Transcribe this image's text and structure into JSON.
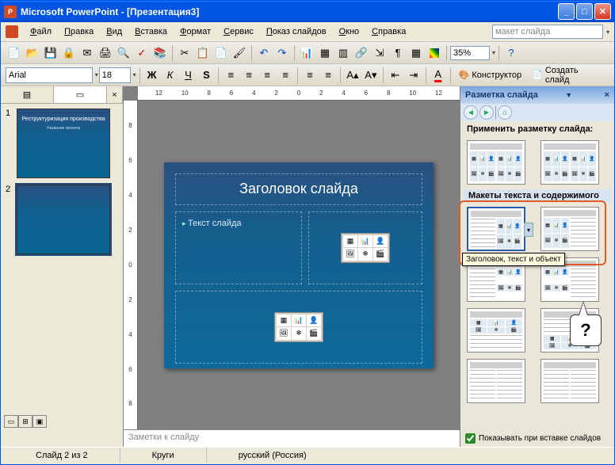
{
  "app": {
    "title": "Microsoft PowerPoint - [Презентация3]"
  },
  "menu": {
    "items": [
      "Файл",
      "Правка",
      "Вид",
      "Вставка",
      "Формат",
      "Сервис",
      "Показ слайдов",
      "Окно",
      "Справка"
    ],
    "help_box": "макет слайда"
  },
  "toolbar": {
    "zoom": "35%"
  },
  "format": {
    "font": "Arial",
    "size": "18",
    "designer": "Конструктор",
    "new_slide": "Создать слайд"
  },
  "thumbs": {
    "slide1": {
      "num": "1",
      "title": "Реструктуризация производства",
      "sub": "Название проекта"
    },
    "slide2": {
      "num": "2"
    }
  },
  "ruler_h": [
    "12",
    "10",
    "8",
    "6",
    "4",
    "2",
    "0",
    "2",
    "4",
    "6",
    "8",
    "10",
    "12"
  ],
  "ruler_v": [
    "8",
    "6",
    "4",
    "2",
    "0",
    "2",
    "4",
    "6",
    "8"
  ],
  "slide": {
    "title": "Заголовок слайда",
    "text": "Текст слайда"
  },
  "taskpane": {
    "header": "Разметка слайда",
    "apply": "Применить разметку слайда:",
    "section": "Макеты текста и содержимого",
    "tooltip": "Заголовок, текст и объект",
    "callout": "?",
    "show_on_insert": "Показывать при вставке слайдов"
  },
  "notes": "Заметки к слайду",
  "status": {
    "slide": "Слайд 2 из 2",
    "design": "Круги",
    "lang": "русский (Россия)"
  }
}
